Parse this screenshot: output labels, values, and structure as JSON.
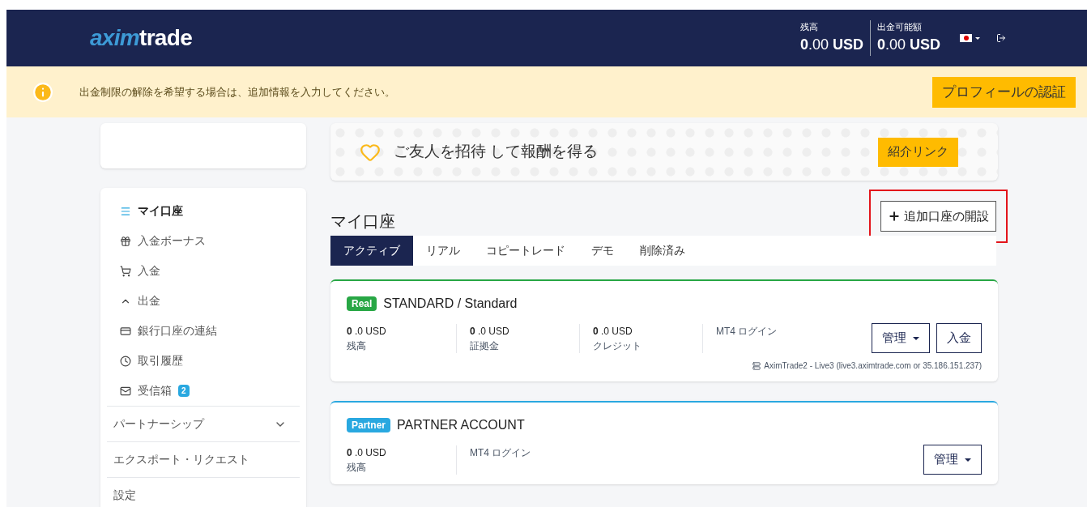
{
  "header": {
    "logo": {
      "part_1": "axim",
      "part_2": "trade"
    },
    "balances": [
      {
        "label": "残高",
        "value": "**0**.00 **USD**"
      },
      {
        "label": "出金可能額",
        "value": "**0**.00 **USD**"
      }
    ]
  },
  "notice": {
    "text": "出金制限の解除を希望する場合は、追加情報を入力してください。",
    "button": "プロフィールの認証"
  },
  "sidebar": {
    "items": [
      {
        "label": "マイ口座",
        "selected": true
      },
      {
        "label": "入金ボーナス",
        "selected": false
      },
      {
        "label": "入金",
        "selected": false
      },
      {
        "label": "出金",
        "selected": false
      },
      {
        "label": "銀行口座の連結",
        "selected": false
      },
      {
        "label": "取引履歴",
        "selected": false
      },
      {
        "label": "受信箱",
        "selected": false,
        "badge": "2"
      }
    ],
    "sections": [
      {
        "label": "パートナーシップ",
        "expanded": false
      },
      {
        "label": "エクスポート・リクエスト"
      },
      {
        "label": "設定"
      }
    ]
  },
  "referral": {
    "text": "ご友人を招待 して報酬を得る",
    "button": "紹介リンク"
  },
  "accounts_section": {
    "title": "マイ口座",
    "open_button": "追加口座の開設",
    "tabs": [
      {
        "label": "アクティブ",
        "selected": true
      },
      {
        "label": "リアル",
        "selected": false
      },
      {
        "label": "コピートレード",
        "selected": false
      },
      {
        "label": "デモ",
        "selected": false
      },
      {
        "label": "削除済み",
        "selected": false
      }
    ]
  },
  "accounts": [
    {
      "badge": "Real",
      "color": "#28a745",
      "name": "STANDARD / Standard",
      "stats": [
        {
          "value": "**0** .0 USD",
          "label": "残高"
        },
        {
          "value": "**0** .0 USD",
          "label": "証拠金"
        },
        {
          "value": "**0** .0 USD",
          "label": "クレジット"
        }
      ],
      "login_label": "MT4 ログイン",
      "buttons": [
        "管理",
        "入金"
      ],
      "server": "AximTrade2 - Live3 (live3.aximtrade.com or 35.186.151.237)"
    },
    {
      "badge": "Partner",
      "color": "#29a8e0",
      "name": "PARTNER ACCOUNT",
      "stats": [
        {
          "value": "**0** .0 USD",
          "label": "残高"
        }
      ],
      "login_label": "MT4 ログイン",
      "buttons": [
        "管理"
      ]
    }
  ]
}
